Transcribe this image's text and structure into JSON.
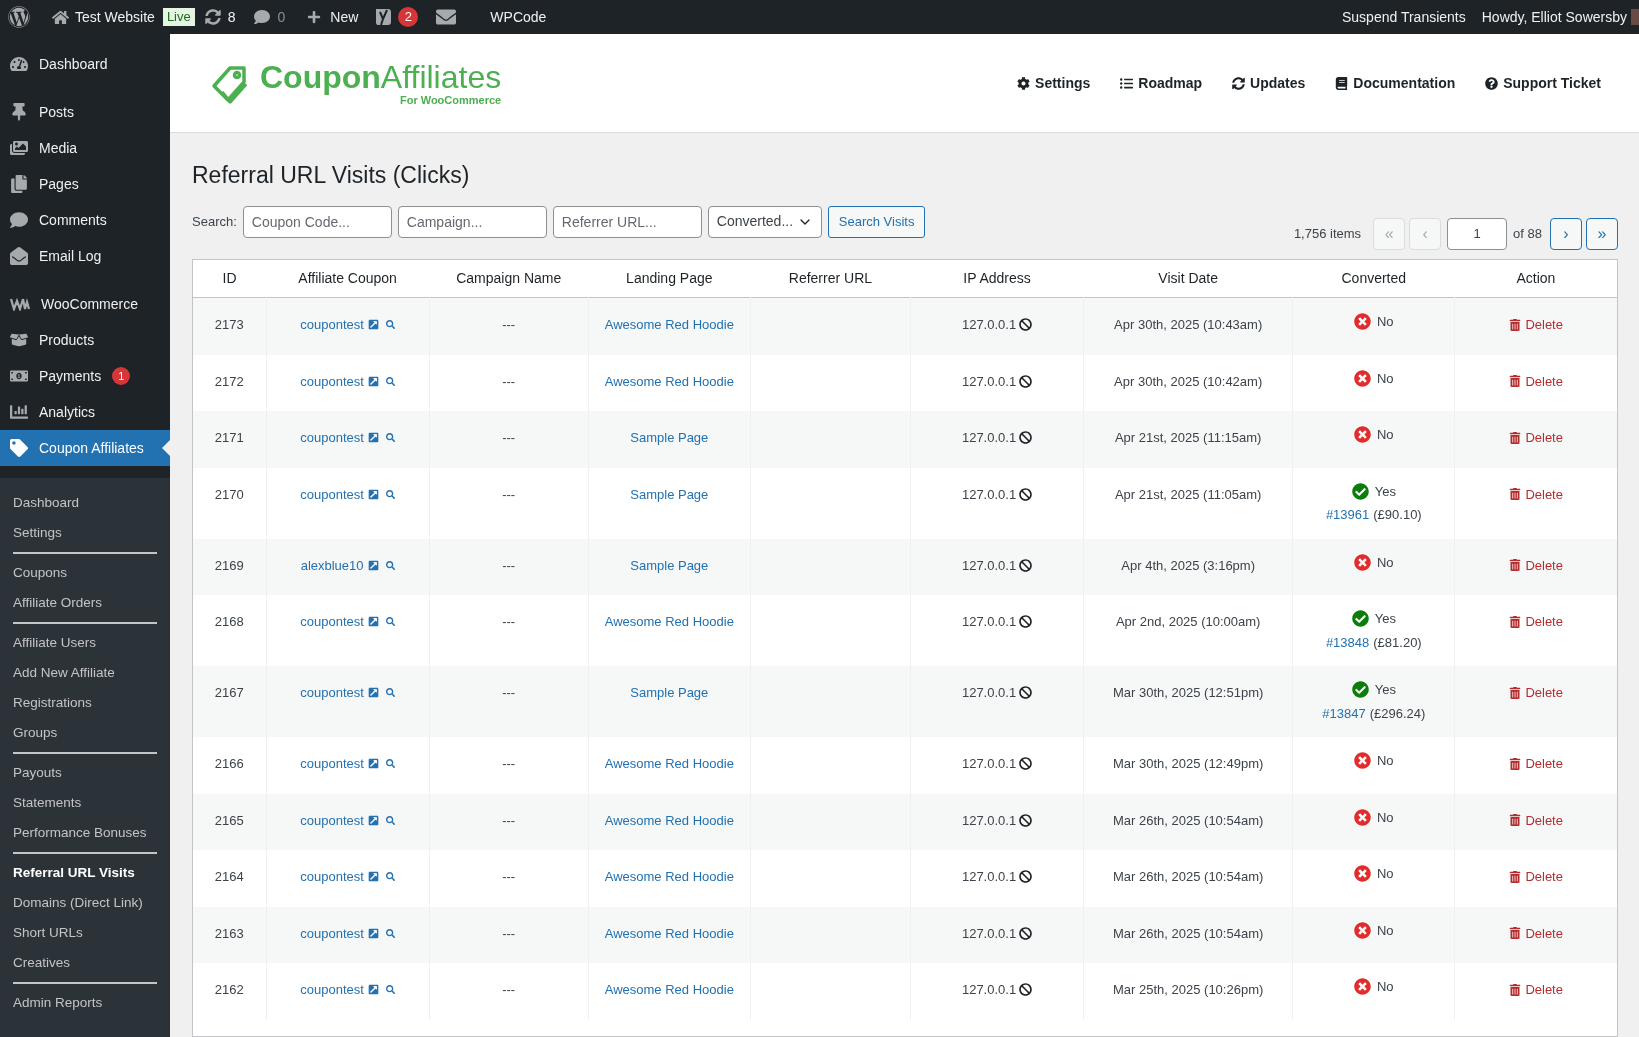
{
  "admin_bar": {
    "site": "Test Website",
    "live": "Live",
    "updates": "8",
    "comments": "0",
    "new": "New",
    "seo_count": "2",
    "wpcode": "WPCode",
    "right": [
      "Suspend Transients",
      "Howdy, Elliot Sowersby"
    ]
  },
  "sidebar": {
    "sections": [
      [
        {
          "label": "Dashboard",
          "selected": false
        }
      ],
      [
        {
          "label": "Posts",
          "selected": false
        },
        {
          "label": "Media",
          "selected": false
        },
        {
          "label": "Pages",
          "selected": false
        },
        {
          "label": "Comments",
          "selected": false
        },
        {
          "label": "Email Log",
          "selected": false
        }
      ],
      [
        {
          "label": "WooCommerce",
          "selected": false
        },
        {
          "label": "Products",
          "selected": false
        },
        {
          "label": "Payments",
          "badge": "1",
          "selected": false
        },
        {
          "label": "Analytics",
          "selected": false
        },
        {
          "label": "Coupon Affiliates",
          "selected": true
        }
      ]
    ],
    "submenu": [
      [
        {
          "label": "Dashboard",
          "selected": false
        },
        {
          "label": "Settings",
          "selected": false
        }
      ],
      [
        {
          "label": "Coupons",
          "selected": false
        },
        {
          "label": "Affiliate Orders",
          "selected": false
        }
      ],
      [
        {
          "label": "Affiliate Users",
          "selected": false
        },
        {
          "label": "Add New Affiliate",
          "selected": false
        },
        {
          "label": "Registrations",
          "selected": false
        },
        {
          "label": "Groups",
          "selected": false
        }
      ],
      [
        {
          "label": "Payouts",
          "selected": false
        },
        {
          "label": "Statements",
          "selected": false
        },
        {
          "label": "Performance Bonuses",
          "selected": false
        }
      ],
      [
        {
          "label": "Referral URL Visits",
          "selected": true
        },
        {
          "label": "Domains (Direct Link)",
          "selected": false
        },
        {
          "label": "Short URLs",
          "selected": false
        },
        {
          "label": "Creatives",
          "selected": false
        }
      ],
      [
        {
          "label": "Admin Reports",
          "selected": false
        }
      ]
    ]
  },
  "header": {
    "logo": {
      "bold": "Coupon",
      "light": "Affiliates",
      "tagline": "For WooCommerce"
    },
    "nav": [
      "Settings",
      "Roadmap",
      "Updates",
      "Documentation",
      "Support Ticket"
    ]
  },
  "title": "Referral URL Visits (Clicks)",
  "search": {
    "label": "Search:",
    "fields": [
      {
        "placeholder": "Coupon Code..."
      },
      {
        "placeholder": "Campaign..."
      },
      {
        "placeholder": "Referrer URL..."
      }
    ],
    "select": "Converted...",
    "button": "Search Visits"
  },
  "pagination": {
    "count": "1,756 items",
    "first": {
      "label": "«",
      "disabled": true
    },
    "prev": {
      "label": "‹",
      "disabled": true
    },
    "page": "1",
    "of": "of 88",
    "next": {
      "label": "›",
      "disabled": false
    },
    "last": {
      "label": "»",
      "disabled": false
    }
  },
  "table": {
    "columns": [
      "ID",
      "Affiliate Coupon",
      "Campaign Name",
      "Landing Page",
      "Referrer URL",
      "IP Address",
      "Visit Date",
      "Converted",
      "Action"
    ],
    "rows": [
      {
        "id": "2173",
        "coupon": "coupontest",
        "campaign": "---",
        "landing": "Awesome Red Hoodie",
        "ip": "127.0.0.1",
        "date": "Apr 30th, 2025 (10:43am)",
        "converted": false,
        "status": "No",
        "action": "Delete"
      },
      {
        "id": "2172",
        "coupon": "coupontest",
        "campaign": "---",
        "landing": "Awesome Red Hoodie",
        "ip": "127.0.0.1",
        "date": "Apr 30th, 2025 (10:42am)",
        "converted": false,
        "status": "No",
        "action": "Delete"
      },
      {
        "id": "2171",
        "coupon": "coupontest",
        "campaign": "---",
        "landing": "Sample Page",
        "ip": "127.0.0.1",
        "date": "Apr 21st, 2025 (11:15am)",
        "converted": false,
        "status": "No",
        "action": "Delete"
      },
      {
        "id": "2170",
        "coupon": "coupontest",
        "campaign": "---",
        "landing": "Sample Page",
        "ip": "127.0.0.1",
        "date": "Apr 21st, 2025 (11:05am)",
        "converted": true,
        "status": "Yes",
        "order": "#13961",
        "amount": "(£90.10)",
        "action": "Delete"
      },
      {
        "id": "2169",
        "coupon": "alexblue10",
        "campaign": "---",
        "landing": "Sample Page",
        "ip": "127.0.0.1",
        "date": "Apr 4th, 2025 (3:16pm)",
        "converted": false,
        "status": "No",
        "action": "Delete"
      },
      {
        "id": "2168",
        "coupon": "coupontest",
        "campaign": "---",
        "landing": "Awesome Red Hoodie",
        "ip": "127.0.0.1",
        "date": "Apr 2nd, 2025 (10:00am)",
        "converted": true,
        "status": "Yes",
        "order": "#13848",
        "amount": "(£81.20)",
        "action": "Delete"
      },
      {
        "id": "2167",
        "coupon": "coupontest",
        "campaign": "---",
        "landing": "Sample Page",
        "ip": "127.0.0.1",
        "date": "Mar 30th, 2025 (12:51pm)",
        "converted": true,
        "status": "Yes",
        "order": "#13847",
        "amount": "(£296.24)",
        "action": "Delete"
      },
      {
        "id": "2166",
        "coupon": "coupontest",
        "campaign": "---",
        "landing": "Awesome Red Hoodie",
        "ip": "127.0.0.1",
        "date": "Mar 30th, 2025 (12:49pm)",
        "converted": false,
        "status": "No",
        "action": "Delete"
      },
      {
        "id": "2165",
        "coupon": "coupontest",
        "campaign": "---",
        "landing": "Awesome Red Hoodie",
        "ip": "127.0.0.1",
        "date": "Mar 26th, 2025 (10:54am)",
        "converted": false,
        "status": "No",
        "action": "Delete"
      },
      {
        "id": "2164",
        "coupon": "coupontest",
        "campaign": "---",
        "landing": "Awesome Red Hoodie",
        "ip": "127.0.0.1",
        "date": "Mar 26th, 2025 (10:54am)",
        "converted": false,
        "status": "No",
        "action": "Delete"
      },
      {
        "id": "2163",
        "coupon": "coupontest",
        "campaign": "---",
        "landing": "Awesome Red Hoodie",
        "ip": "127.0.0.1",
        "date": "Mar 26th, 2025 (10:54am)",
        "converted": false,
        "status": "No",
        "action": "Delete"
      },
      {
        "id": "2162",
        "coupon": "coupontest",
        "campaign": "---",
        "landing": "Awesome Red Hoodie",
        "ip": "127.0.0.1",
        "date": "Mar 25th, 2025 (10:26pm)",
        "converted": false,
        "status": "No",
        "action": "Delete"
      }
    ]
  }
}
